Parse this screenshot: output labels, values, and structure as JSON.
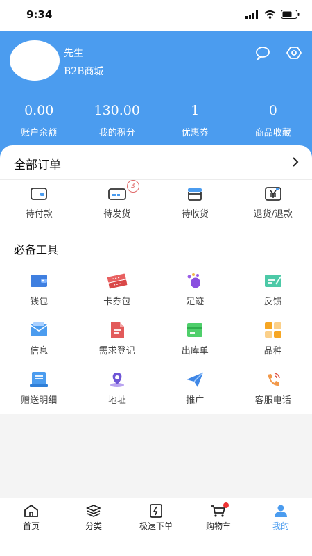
{
  "status_bar": {
    "time": "9:34"
  },
  "profile": {
    "name": "先生",
    "subtitle": "B2B商城"
  },
  "stats": [
    {
      "value": "0.00",
      "label": "账户余额"
    },
    {
      "value": "130.00",
      "label": "我的积分"
    },
    {
      "value": "1",
      "label": "优惠券"
    },
    {
      "value": "0",
      "label": "商品收藏"
    }
  ],
  "orders": {
    "title": "全部订单",
    "items": [
      {
        "label": "待付款",
        "icon": "wallet-icon"
      },
      {
        "label": "待发货",
        "icon": "truck-icon",
        "badge": "3"
      },
      {
        "label": "待收货",
        "icon": "package-icon"
      },
      {
        "label": "退货/退款",
        "icon": "refund-icon"
      }
    ]
  },
  "tools": {
    "title": "必备工具",
    "items": [
      {
        "label": "钱包",
        "icon": "wallet-icon"
      },
      {
        "label": "卡券包",
        "icon": "coupon-icon"
      },
      {
        "label": "足迹",
        "icon": "footprint-icon"
      },
      {
        "label": "反馈",
        "icon": "feedback-icon"
      },
      {
        "label": "信息",
        "icon": "message-icon"
      },
      {
        "label": "需求登记",
        "icon": "document-icon"
      },
      {
        "label": "出库单",
        "icon": "outbound-icon"
      },
      {
        "label": "品种",
        "icon": "category-icon"
      },
      {
        "label": "赠送明细",
        "icon": "gift-detail-icon"
      },
      {
        "label": "地址",
        "icon": "location-icon"
      },
      {
        "label": "推广",
        "icon": "send-icon"
      },
      {
        "label": "客服电话",
        "icon": "phone-icon"
      }
    ]
  },
  "tabs": [
    {
      "label": "首页",
      "icon": "home-icon"
    },
    {
      "label": "分类",
      "icon": "layers-icon"
    },
    {
      "label": "极速下单",
      "icon": "quick-order-icon"
    },
    {
      "label": "购物车",
      "icon": "cart-icon"
    },
    {
      "label": "我的",
      "icon": "user-icon",
      "active": true
    }
  ],
  "colors": {
    "primary": "#4b9cef",
    "background": "#f4f4f4",
    "badge": "#e06a6a",
    "cart_dot": "#ee3333"
  }
}
